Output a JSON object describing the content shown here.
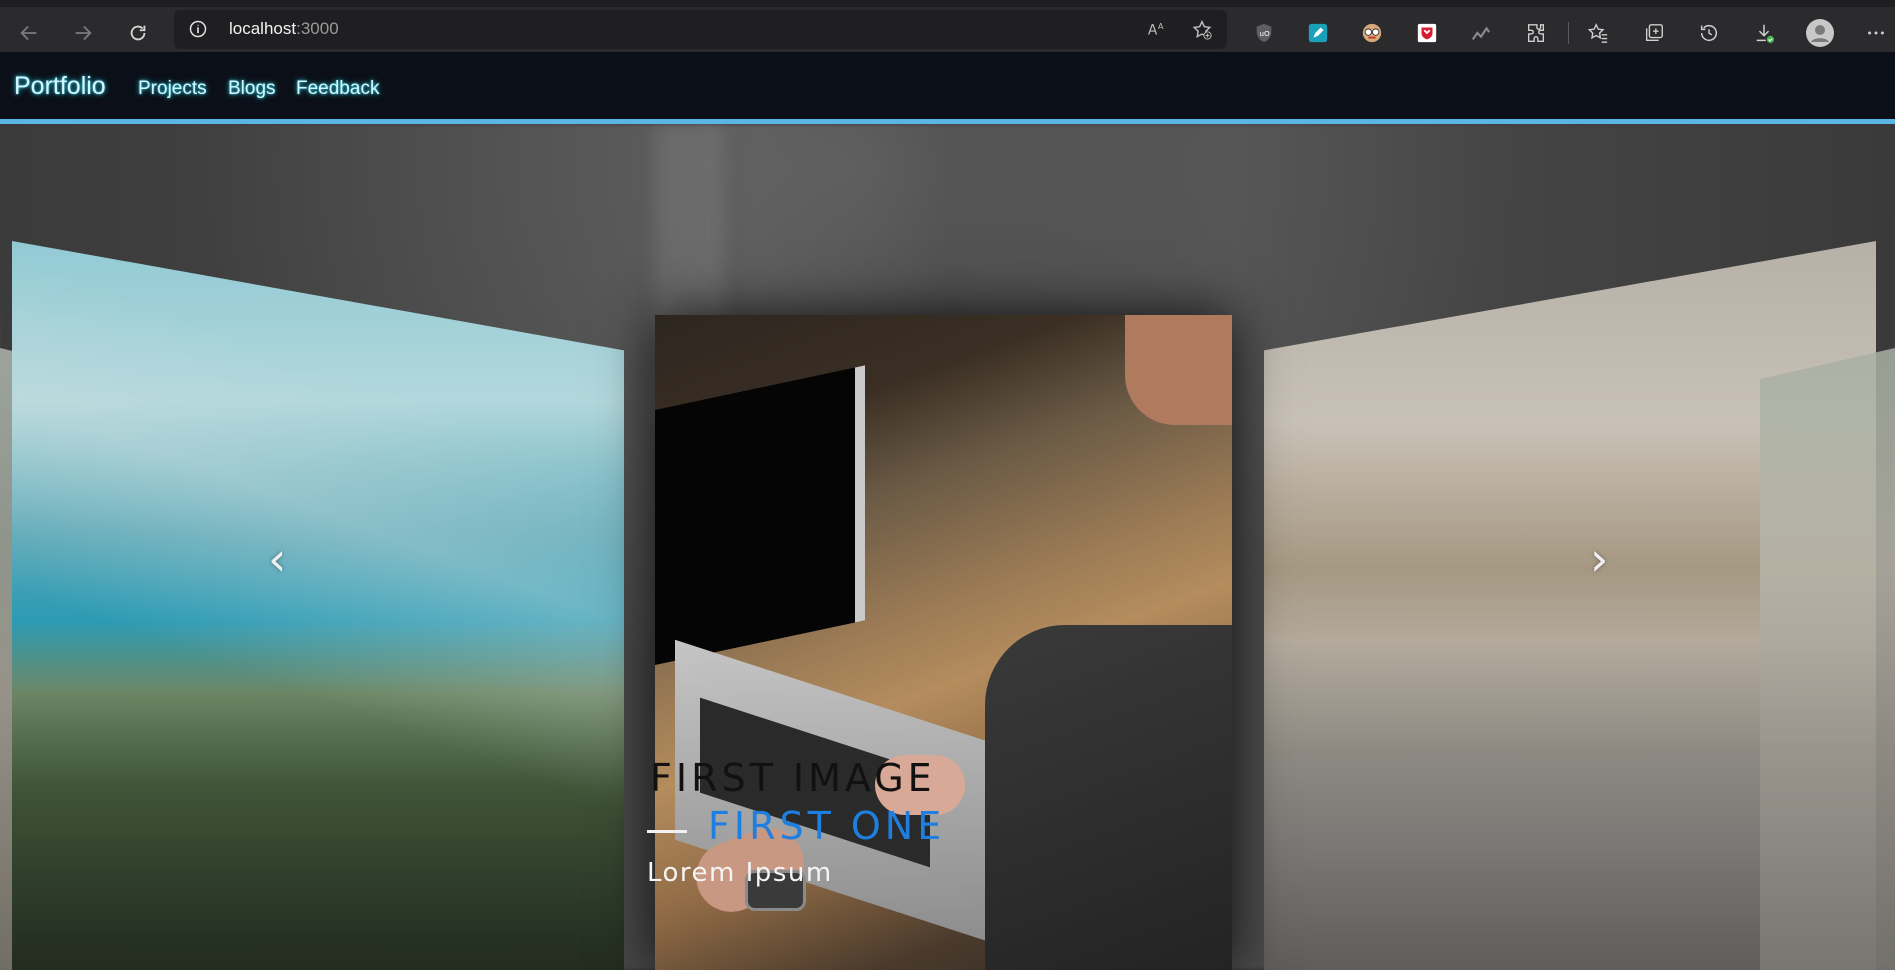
{
  "browser": {
    "url_host": "localhost",
    "url_port": ":3000"
  },
  "nav": {
    "brand": "Portfolio",
    "links": [
      "Projects",
      "Blogs",
      "Feedback"
    ]
  },
  "carousel": {
    "caption_title": "FIRST IMAGE",
    "caption_subtitle": "FIRST ONE",
    "caption_text": "Lorem Ipsum",
    "prev_arrow": "‹",
    "next_arrow": "›"
  },
  "colors": {
    "navbar_bg": "#0b0f17",
    "navbar_border": "#59b6e6",
    "nav_glow": "#2ec4d8",
    "caption_accent": "#1e7fe0"
  }
}
